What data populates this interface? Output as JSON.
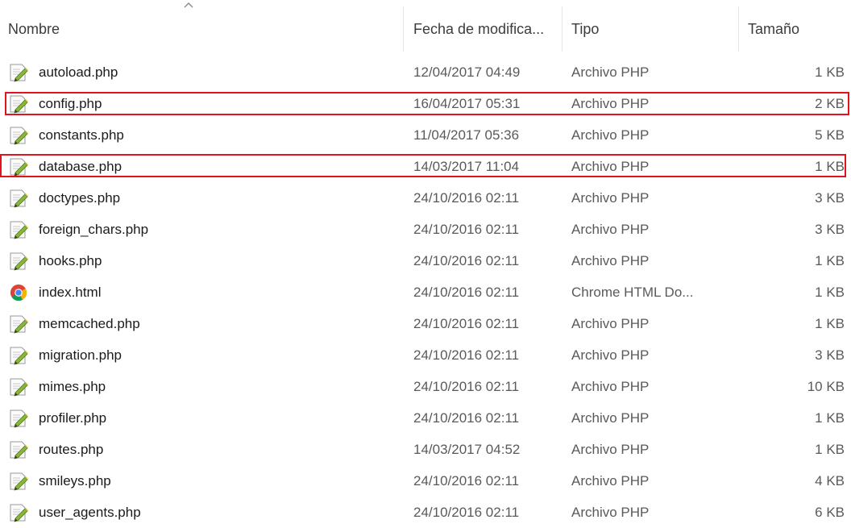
{
  "columns": {
    "name": "Nombre",
    "date": "Fecha de modifica...",
    "type": "Tipo",
    "size": "Tamaño"
  },
  "sort_indicator": "chevron-up-icon",
  "files": [
    {
      "name": "autoload.php",
      "date": "12/04/2017 04:49",
      "type": "Archivo PHP",
      "size": "1 KB",
      "icon": "php-file-icon",
      "highlighted": false
    },
    {
      "name": "config.php",
      "date": "16/04/2017 05:31",
      "type": "Archivo PHP",
      "size": "2 KB",
      "icon": "php-file-icon",
      "highlighted": true
    },
    {
      "name": "constants.php",
      "date": "11/04/2017 05:36",
      "type": "Archivo PHP",
      "size": "5 KB",
      "icon": "php-file-icon",
      "highlighted": false
    },
    {
      "name": "database.php",
      "date": "14/03/2017 11:04",
      "type": "Archivo PHP",
      "size": "1 KB",
      "icon": "php-file-icon",
      "highlighted": true
    },
    {
      "name": "doctypes.php",
      "date": "24/10/2016 02:11",
      "type": "Archivo PHP",
      "size": "3 KB",
      "icon": "php-file-icon",
      "highlighted": false
    },
    {
      "name": "foreign_chars.php",
      "date": "24/10/2016 02:11",
      "type": "Archivo PHP",
      "size": "3 KB",
      "icon": "php-file-icon",
      "highlighted": false
    },
    {
      "name": "hooks.php",
      "date": "24/10/2016 02:11",
      "type": "Archivo PHP",
      "size": "1 KB",
      "icon": "php-file-icon",
      "highlighted": false
    },
    {
      "name": "index.html",
      "date": "24/10/2016 02:11",
      "type": "Chrome HTML Do...",
      "size": "1 KB",
      "icon": "chrome-icon",
      "highlighted": false
    },
    {
      "name": "memcached.php",
      "date": "24/10/2016 02:11",
      "type": "Archivo PHP",
      "size": "1 KB",
      "icon": "php-file-icon",
      "highlighted": false
    },
    {
      "name": "migration.php",
      "date": "24/10/2016 02:11",
      "type": "Archivo PHP",
      "size": "3 KB",
      "icon": "php-file-icon",
      "highlighted": false
    },
    {
      "name": "mimes.php",
      "date": "24/10/2016 02:11",
      "type": "Archivo PHP",
      "size": "10 KB",
      "icon": "php-file-icon",
      "highlighted": false
    },
    {
      "name": "profiler.php",
      "date": "24/10/2016 02:11",
      "type": "Archivo PHP",
      "size": "1 KB",
      "icon": "php-file-icon",
      "highlighted": false
    },
    {
      "name": "routes.php",
      "date": "14/03/2017 04:52",
      "type": "Archivo PHP",
      "size": "1 KB",
      "icon": "php-file-icon",
      "highlighted": false
    },
    {
      "name": "smileys.php",
      "date": "24/10/2016 02:11",
      "type": "Archivo PHP",
      "size": "4 KB",
      "icon": "php-file-icon",
      "highlighted": false
    },
    {
      "name": "user_agents.php",
      "date": "24/10/2016 02:11",
      "type": "Archivo PHP",
      "size": "6 KB",
      "icon": "php-file-icon",
      "highlighted": false
    }
  ],
  "colors": {
    "highlight_border": "#e0141e"
  }
}
